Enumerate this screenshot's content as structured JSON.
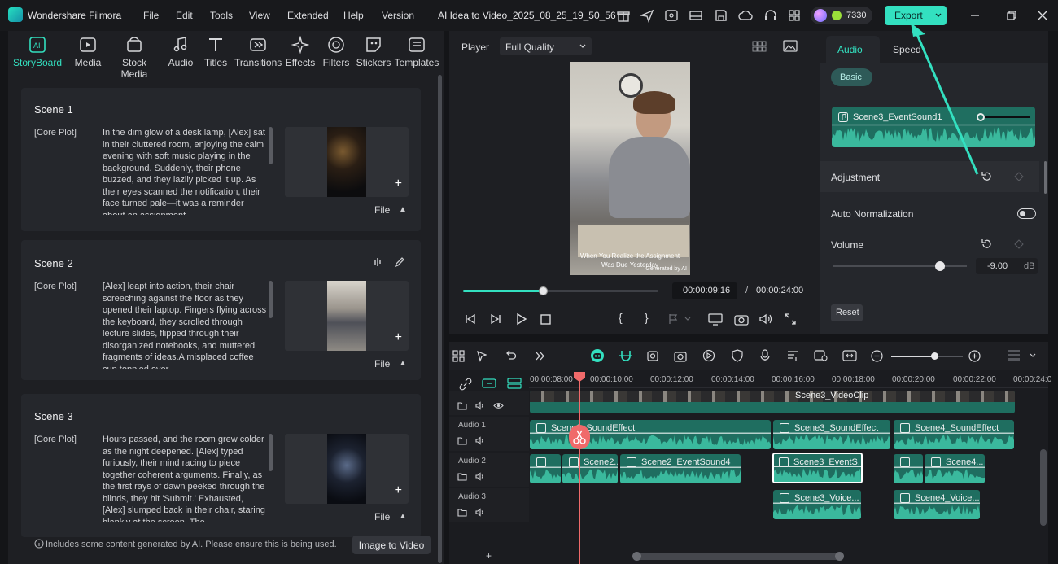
{
  "titlebar": {
    "app_name": "Wondershare Filmora",
    "menus": [
      "File",
      "Edit",
      "Tools",
      "View",
      "Extended",
      "Help",
      "Version"
    ],
    "project_title": "AI Idea to Video_2025_08_25_19_50_56",
    "credits": "7330",
    "export_label": "Export"
  },
  "left": {
    "tabs": [
      "StoryBoard",
      "Media",
      "Stock Media",
      "Audio",
      "Titles",
      "Transitions",
      "Effects",
      "Filters",
      "Stickers",
      "Templates"
    ],
    "scenes": [
      {
        "title": "Scene 1",
        "tag": "[Core Plot]",
        "text": "In the dim glow of a desk lamp, [Alex] sat in their cluttered room, enjoying the calm evening with soft music playing in the background. Suddenly, their phone buzzed, and they lazily picked it up. As their eyes scanned the notification, their face turned pale—it was a reminder about an assignment",
        "file": "File"
      },
      {
        "title": "Scene 2",
        "tag": "[Core Plot]",
        "text": "[Alex] leapt into action, their chair screeching against the floor as they opened their laptop. Fingers flying across the keyboard, they scrolled through lecture slides, flipped through their disorganized notebooks, and muttered fragments of ideas.A misplaced coffee cup toppled over",
        "file": "File"
      },
      {
        "title": "Scene 3",
        "tag": "[Core Plot]",
        "text": "Hours passed, and the room grew colder as the night deepened. [Alex] typed furiously, their mind racing to piece together coherent arguments. Finally, as the first rays of dawn peeked through the blinds, they hit 'Submit.' Exhausted, [Alex] slumped back in their chair, staring blankly at the screen. The",
        "file": "File"
      }
    ],
    "footer_note": "Includes some content generated by AI. Please ensure this is being used.",
    "image_to_video": "Image to Video"
  },
  "player": {
    "label": "Player",
    "quality": "Full Quality",
    "caption": "When You Realize the Assignment Was Due Yesterday",
    "ai_badge": "Generated by AI",
    "current_time": "00:00:09:16",
    "separator": "/",
    "total_time": "00:00:24:00",
    "progress": 0.41
  },
  "props": {
    "tab_audio": "Audio",
    "tab_speed": "Speed",
    "basic": "Basic",
    "clip_name": "Scene3_EventSound1",
    "adjustment": "Adjustment",
    "auto_norm": "Auto Normalization",
    "volume": "Volume",
    "volume_value": "-9.00",
    "volume_unit": "dB",
    "volume_level": 0.8,
    "reset": "Reset"
  },
  "timeline": {
    "ruler": [
      "00:00:08:00",
      "00:00:10:00",
      "00:00:12:00",
      "00:00:14:00",
      "00:00:16:00",
      "00:00:18:00",
      "00:00:20:00",
      "00:00:22:00",
      "00:00:24:0"
    ],
    "track_audio1": "Audio 1",
    "track_audio2": "Audio 2",
    "track_audio3": "Audio 3",
    "clip_video": "Scene3_VideoClip",
    "clip_a1_1": "Scene2_SoundEffect",
    "clip_a1_2": "Scene3_SoundEffect",
    "clip_a1_3": "Scene4_SoundEffect",
    "clip_a2_1": "Scene2...",
    "clip_a2_2": "Scene2_EventSound4",
    "clip_a2_3": "Scene3_EventS...",
    "clip_a2_4": "Scene4...",
    "clip_a3_1": "Scene3_Voice...",
    "clip_a3_2": "Scene4_Voice...",
    "zoom_level": 0.6
  },
  "colors": {
    "accent": "#33e0c0",
    "playhead": "#f06a6a",
    "audio_clip": "#1f6e60",
    "wave": "#3fc7a8"
  }
}
